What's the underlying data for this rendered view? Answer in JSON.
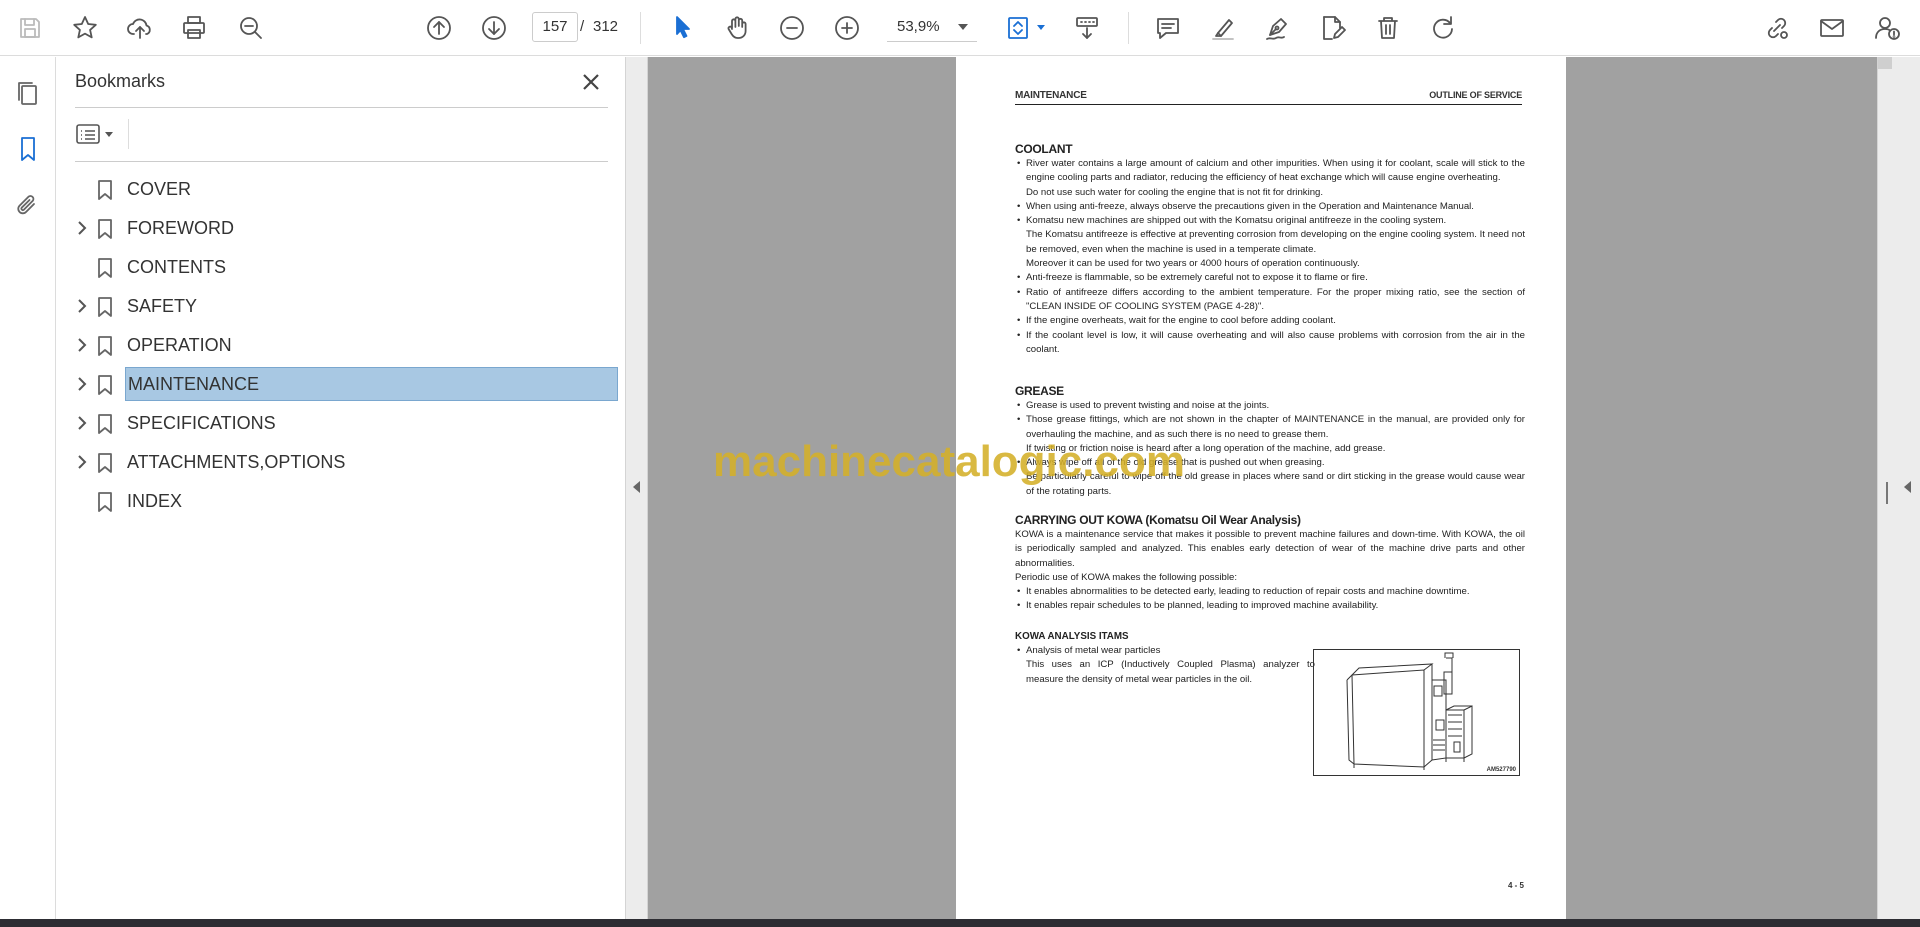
{
  "toolbar": {
    "current_page": "157",
    "page_separator": "/",
    "total_pages": "312",
    "zoom": "53,9%"
  },
  "bookmarks": {
    "title": "Bookmarks",
    "items": [
      {
        "label": "COVER",
        "expandable": false,
        "selected": false
      },
      {
        "label": "FOREWORD",
        "expandable": true,
        "selected": false
      },
      {
        "label": "CONTENTS",
        "expandable": false,
        "selected": false
      },
      {
        "label": "SAFETY",
        "expandable": true,
        "selected": false
      },
      {
        "label": "OPERATION",
        "expandable": true,
        "selected": false
      },
      {
        "label": "MAINTENANCE",
        "expandable": true,
        "selected": true
      },
      {
        "label": "SPECIFICATIONS",
        "expandable": true,
        "selected": false
      },
      {
        "label": "ATTACHMENTS,OPTIONS",
        "expandable": true,
        "selected": false
      },
      {
        "label": "INDEX",
        "expandable": false,
        "selected": false
      }
    ]
  },
  "document": {
    "header_left": "MAINTENANCE",
    "header_right": "OUTLINE OF SERVICE",
    "coolant": {
      "title": "COOLANT",
      "b1": "River water contains a large amount of calcium and other impurities. When using it for coolant, scale will stick to the engine cooling parts and radiator, reducing the efficiency of heat exchange which will cause engine overheating.",
      "b1a": "Do not use such water for cooling the engine that is not fit for drinking.",
      "b2": "When using anti-freeze, always observe the precautions given in the Operation and Maintenance Manual.",
      "b3": "Komatsu new machines are shipped out with the Komatsu original antifreeze in the cooling system.",
      "b3a": "The Komatsu antifreeze is effective at preventing corrosion from developing on the engine cooling system. It need not be removed, even when the machine is used in a temperate climate.",
      "b3b": "Moreover it can be used for two years or 4000 hours of operation continuously.",
      "b4": "Anti-freeze is flammable, so be extremely careful not to expose it to flame or fire.",
      "b5": "Ratio of antifreeze differs according to the ambient temperature. For the proper mixing ratio, see the section of \"CLEAN INSIDE OF COOLING SYSTEM (PAGE 4-28)\".",
      "b6": "If the engine overheats, wait for the engine to cool before adding coolant.",
      "b7": "If the coolant level is low, it will cause overheating and will also cause problems with corrosion from the air in the coolant."
    },
    "grease": {
      "title": "GREASE",
      "b1": "Grease is used to prevent twisting and noise at the joints.",
      "b2": "Those grease fittings, which are not shown in the chapter of MAINTENANCE in the manual, are provided only for overhauling the machine, and as such there is no need to grease them.",
      "b2a": "If twisting or friction noise is heard after a long operation of the machine, add grease.",
      "b3": "Always wipe off all of the old grease that is pushed out when greasing.",
      "b3a": "Be particularly careful to wipe off the old grease in places where sand or dirt sticking in the grease would cause wear of the rotating parts."
    },
    "kowa": {
      "title": "CARRYING OUT KOWA (Komatsu Oil Wear Analysis)",
      "p1": "KOWA is a maintenance service that makes it possible to prevent machine failures and down-time. With KOWA, the oil is periodically sampled and analyzed. This enables early detection of wear of the machine drive parts and other abnormalities.",
      "p2": "Periodic use of KOWA makes the following possible:",
      "b1": "It enables abnormalities to be detected early, leading to reduction of repair costs and machine downtime.",
      "b2": "It enables repair schedules to be planned, leading to improved machine availability."
    },
    "analysis": {
      "title": "KOWA ANALYSIS ITAMS",
      "b1": "Analysis of metal wear particles",
      "b1a": "This uses an ICP (Inductively Coupled Plasma) analyzer to measure the density of metal wear particles in the oil."
    },
    "figure_code": "AM527790",
    "page_number": "4 - 5"
  },
  "watermark": "machinecatalogic.com"
}
